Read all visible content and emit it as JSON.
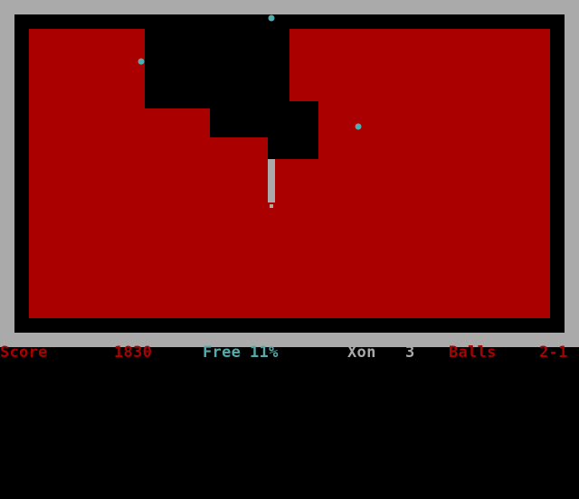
{
  "colors": {
    "border": "#aaaaaa",
    "claimed": "#000000",
    "unclaimed": "#aa0000",
    "ball": "#55aaaa",
    "trail": "#aaaaaa",
    "hud_red": "#aa0000",
    "hud_cyan": "#55aaaa",
    "hud_gray": "#aaaaaa"
  },
  "hud": {
    "score_label": "Score",
    "score_value": "1830",
    "free_label": "Free",
    "free_value": "11%",
    "xon_label": "Xon",
    "xon_value": "3",
    "balls_label": "Balls",
    "balls_value": "2-1"
  }
}
